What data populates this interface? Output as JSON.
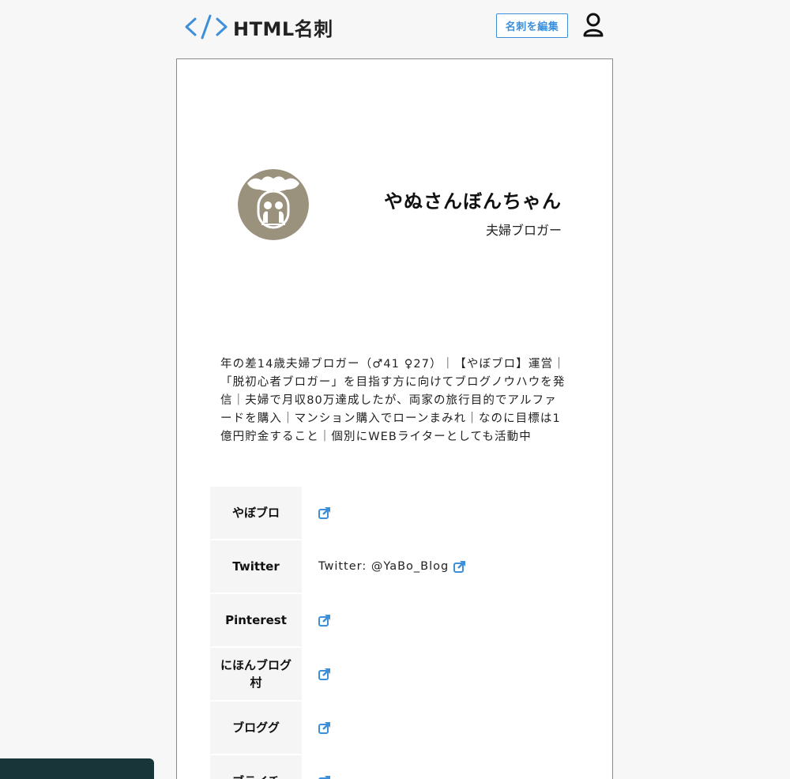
{
  "header": {
    "logo_symbol": "</>",
    "logo_text": "HTML名刺",
    "edit_button": "名刺を編集",
    "user_icon": "user-icon",
    "accent_color": "#3c8fd8"
  },
  "profile": {
    "name": "やぬさんぼんちゃん",
    "role": "夫婦ブロガー",
    "bio": "年の差14歳夫婦ブロガー（♂41 ♀27）｜【やぼブロ】運営｜「脱初心者ブロガー」を目指す方に向けてブログノウハウを発信｜夫婦で月収80万達成したが、両家の旅行目的でアルファードを購入｜マンション購入でローンまみれ｜なのに目標は1億円貯金すること｜個別にWEBライターとしても活動中"
  },
  "links": [
    {
      "label": "やぼブロ",
      "text": ""
    },
    {
      "label": "Twitter",
      "text": "Twitter: @YaBo_Blog"
    },
    {
      "label": "Pinterest",
      "text": ""
    },
    {
      "label": "にほんブログ村",
      "text": ""
    },
    {
      "label": "ブロググ",
      "text": ""
    },
    {
      "label": "ブライチ",
      "text": ""
    }
  ]
}
